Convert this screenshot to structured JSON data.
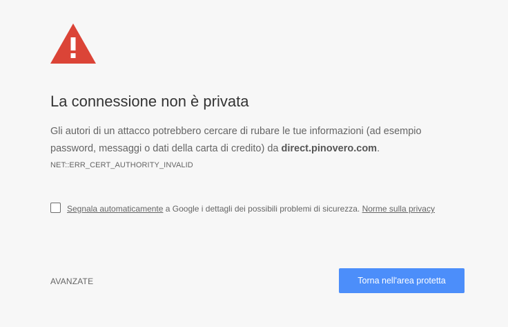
{
  "colors": {
    "background": "#f7f7f7",
    "warning_icon": "#db4437",
    "primary_button": "#4c8efa",
    "title_text": "#333333",
    "body_text": "#646464"
  },
  "icon": {
    "name": "warning-triangle-icon"
  },
  "title": "La connessione non è privata",
  "description": {
    "text_before": "Gli autori di un attacco potrebbero cercare di rubare le tue informazioni (ad esempio password, messaggi o dati della carta di credito) da ",
    "domain": "direct.pinovero.com",
    "text_after": "."
  },
  "error_code": "NET::ERR_CERT_AUTHORITY_INVALID",
  "report": {
    "checked": false,
    "link_label": "Segnala automaticamente",
    "text": " a Google i dettagli dei possibili problemi di sicurezza. ",
    "privacy_label": "Norme sulla privacy"
  },
  "buttons": {
    "advanced_label": "AVANZATE",
    "back_label": "Torna nell'area protetta"
  }
}
